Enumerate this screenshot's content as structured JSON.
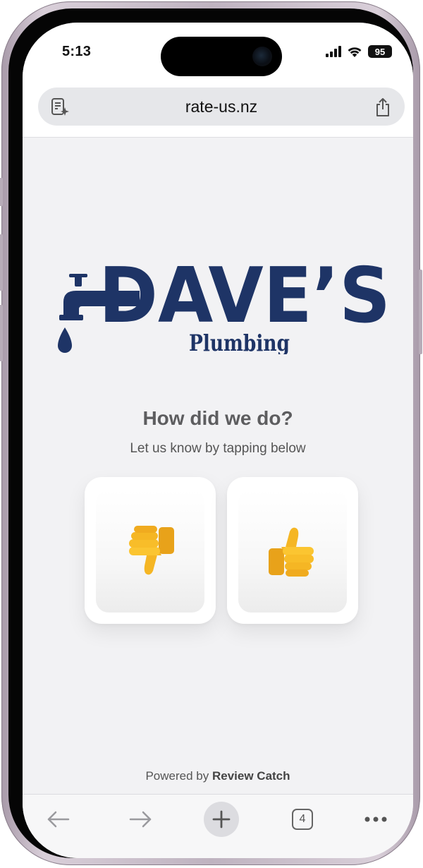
{
  "status_bar": {
    "time": "5:13",
    "battery": "95"
  },
  "browser": {
    "url": "rate-us.nz"
  },
  "logo": {
    "brand": "DAVE’S",
    "subtitle": "Plumbing",
    "color": "#1e3466"
  },
  "page": {
    "heading": "How did we do?",
    "subheading": "Let us know by tapping below",
    "thumbs_down_label": "👎",
    "thumbs_up_label": "👍",
    "powered_prefix": "Powered by",
    "powered_brand": "Review Catch"
  },
  "toolbar": {
    "tab_count": "4",
    "icons": [
      "back-arrow-icon",
      "forward-arrow-icon",
      "plus-icon",
      "tabs-icon",
      "more-icon"
    ]
  }
}
